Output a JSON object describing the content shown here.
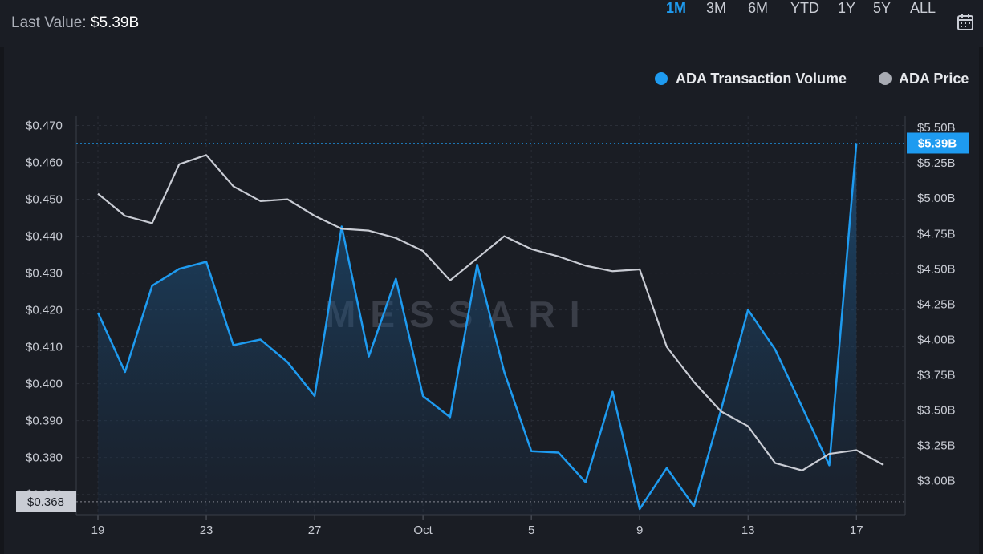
{
  "header": {
    "last_value_label": "Last Value:",
    "last_value": "$5.39B",
    "ranges": [
      "1M",
      "3M",
      "6M",
      "YTD",
      "1Y",
      "5Y",
      "ALL"
    ],
    "active_range": "1M"
  },
  "colors": {
    "volume": "#1e9bf0",
    "price": "#c9ccd4",
    "background": "#1a1d24",
    "price_badge": "#c9ccd4"
  },
  "watermark": "MESSARI",
  "chart_data": {
    "type": "line",
    "legend_position": "top-right",
    "grid": true,
    "x_tick_labels": [
      "19",
      "23",
      "27",
      "Oct",
      "5",
      "9",
      "13",
      "17"
    ],
    "x_tick_days": [
      19,
      23,
      27,
      31,
      35,
      39,
      43,
      47
    ],
    "left_axis": {
      "tick_labels": [
        "$0.470",
        "$0.460",
        "$0.450",
        "$0.440",
        "$0.430",
        "$0.420",
        "$0.410",
        "$0.400",
        "$0.390",
        "$0.380",
        "$0.370"
      ],
      "ylim": [
        0.3645,
        0.4725
      ]
    },
    "right_axis": {
      "tick_labels": [
        "$5.50B",
        "$5.25B",
        "$5.00B",
        "$4.75B",
        "$4.50B",
        "$4.25B",
        "$4.00B",
        "$3.75B",
        "$3.50B",
        "$3.25B",
        "$3.00B"
      ],
      "ylim": [
        2.76,
        5.58
      ]
    },
    "price_badge": "$0.368",
    "volume_badge": "$5.39B",
    "series": [
      {
        "name": "ADA Transaction Volume",
        "axis": "right",
        "days": [
          19,
          20,
          21,
          22,
          23,
          24,
          25,
          26,
          27,
          28,
          29,
          30,
          31,
          32,
          33,
          34,
          35,
          36,
          37,
          38,
          39,
          40,
          41,
          42,
          43,
          44,
          45,
          46,
          47
        ],
        "values": [
          4.19,
          3.77,
          4.38,
          4.5,
          4.55,
          3.96,
          4.0,
          3.84,
          3.6,
          4.8,
          3.88,
          4.43,
          3.6,
          3.45,
          4.53,
          3.77,
          3.21,
          3.2,
          2.99,
          3.63,
          2.8,
          3.09,
          2.82,
          3.5,
          4.21,
          3.93,
          3.52,
          3.11,
          5.39
        ]
      },
      {
        "name": "ADA Price",
        "axis": "left",
        "days": [
          19,
          20,
          21,
          22,
          23,
          24,
          25,
          26,
          27,
          28,
          29,
          30,
          31,
          32,
          33,
          34,
          35,
          36,
          37,
          38,
          39,
          40,
          41,
          42,
          43,
          44,
          45,
          46,
          47,
          48
        ],
        "values": [
          0.4515,
          0.4455,
          0.4435,
          0.4595,
          0.462,
          0.4535,
          0.4495,
          0.45,
          0.4455,
          0.442,
          0.4415,
          0.4395,
          0.436,
          0.428,
          0.434,
          0.44,
          0.4365,
          0.4345,
          0.432,
          0.4305,
          0.431,
          0.41,
          0.4005,
          0.3925,
          0.3885,
          0.3785,
          0.3765,
          0.381,
          0.382,
          0.378
        ]
      }
    ]
  }
}
